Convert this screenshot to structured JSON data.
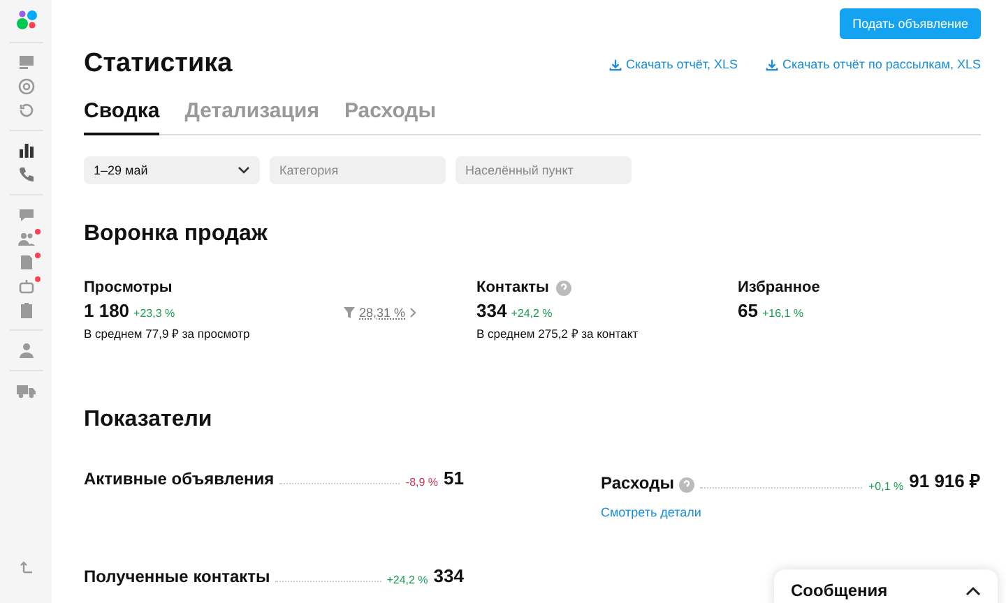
{
  "sidebar": {
    "groups": [
      [
        {
          "kind": "logo",
          "dot": false
        }
      ],
      [
        {
          "kind": "ads",
          "dot": false
        },
        {
          "kind": "promo",
          "dot": false
        },
        {
          "kind": "history",
          "dot": false
        }
      ],
      [
        {
          "kind": "stats",
          "dot": false
        },
        {
          "kind": "phone",
          "dot": false
        }
      ],
      [
        {
          "kind": "chat",
          "dot": false
        },
        {
          "kind": "people",
          "dot": true
        },
        {
          "kind": "doc",
          "dot": true
        },
        {
          "kind": "bot",
          "dot": true
        },
        {
          "kind": "clipboard",
          "dot": false
        }
      ],
      [
        {
          "kind": "user",
          "dot": false
        }
      ],
      [
        {
          "kind": "truck",
          "dot": false
        }
      ]
    ],
    "footer": {
      "kind": "collapse"
    }
  },
  "header": {
    "title": "Статистика",
    "post_button": "Подать объявление",
    "downloads": [
      "Скачать отчёт, XLS",
      "Скачать отчёт по рассылкам, XLS"
    ]
  },
  "tabs": [
    {
      "label": "Сводка",
      "selected": true
    },
    {
      "label": "Детализация",
      "selected": false
    },
    {
      "label": "Расходы",
      "selected": false
    }
  ],
  "filters": [
    {
      "kind": "dropdown",
      "value": "1–29 май"
    },
    {
      "kind": "field",
      "placeholder": "Категория"
    },
    {
      "kind": "field",
      "placeholder": "Населённый пункт"
    }
  ],
  "funnel": {
    "title": "Воронка продаж",
    "metrics": [
      {
        "label": "Просмотры",
        "help": false,
        "value": "1 180",
        "delta": "+23,3 %",
        "color": "#1a9e55",
        "note": "В среднем 77,9 ₽ за просмотр"
      },
      {
        "label": "Контакты",
        "help": true,
        "value": "334",
        "delta": "+24,2 %",
        "color": "#1a9e55",
        "note": "В среднем 275,2 ₽ за контакт"
      },
      {
        "label": "Избранное",
        "help": false,
        "value": "65",
        "delta": "+16,1 %",
        "color": "#1a9e55"
      }
    ],
    "conversion": "28,31 %"
  },
  "indicators": {
    "title": "Показатели",
    "rows": [
      {
        "label": "Активные объявления",
        "help": false,
        "delta": "-8,9 %",
        "color": "#d0395a",
        "value": "51"
      },
      {
        "label": "Расходы",
        "help": true,
        "delta": "+0,1 %",
        "color": "#1a9e55",
        "value": "91 916 ₽",
        "link": "Смотреть детали"
      },
      {
        "label": "Полученные контакты",
        "help": false,
        "delta": "+24,2 %",
        "color": "#1a9e55",
        "value": "334"
      }
    ]
  },
  "messages_panel": {
    "title": "Сообщения",
    "expanded": false
  }
}
